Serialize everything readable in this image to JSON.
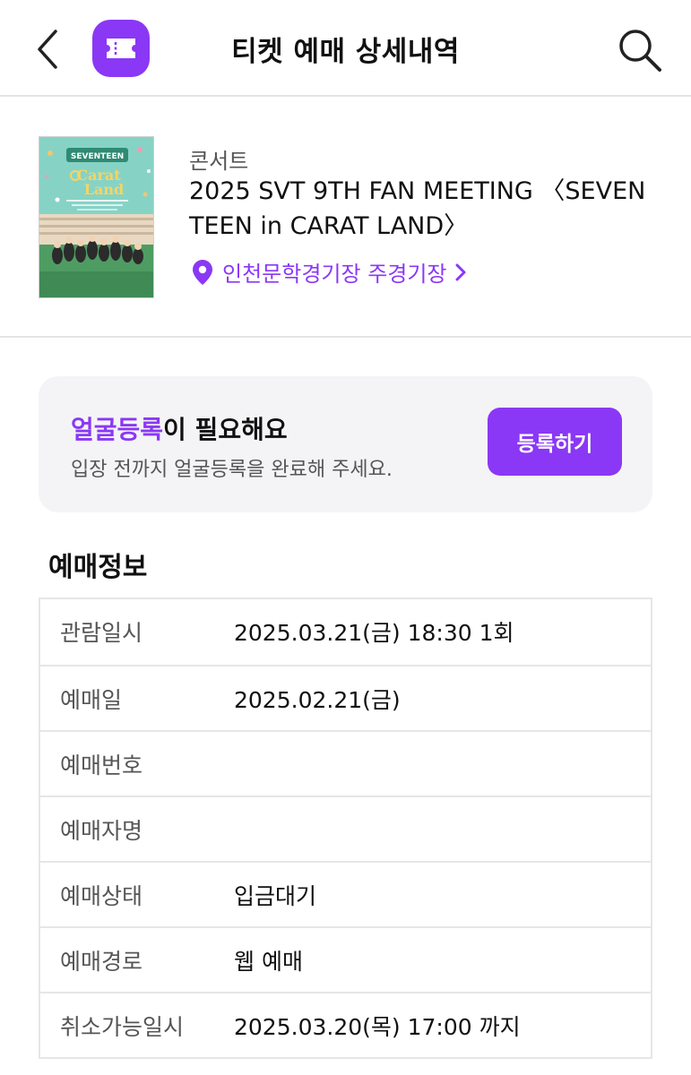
{
  "header": {
    "title": "티켓 예매 상세내역",
    "back_icon": "chevron-left-icon",
    "app_icon": "ticket-icon",
    "search_icon": "search-icon"
  },
  "event": {
    "category": "콘서트",
    "title": "2025 SVT 9TH FAN MEETING 〈SEVENTEEN in CARAT LAND〉",
    "venue": "인천문학경기장 주경기장",
    "poster": {
      "brand": "SEVENTEEN",
      "headline_line1": "Carat",
      "headline_line2": "Land"
    }
  },
  "face_registration": {
    "title_highlight": "얼굴등록",
    "title_rest": "이 필요해요",
    "subtitle": "입장 전까지 얼굴등록을 완료해 주세요.",
    "button_label": "등록하기"
  },
  "reservation": {
    "section_title": "예매정보",
    "rows": [
      {
        "label": "관람일시",
        "value": "2025.03.21(금) 18:30 1회"
      },
      {
        "label": "예매일",
        "value": "2025.02.21(금)"
      },
      {
        "label": "예매번호",
        "value": ""
      },
      {
        "label": "예매자명",
        "value": ""
      },
      {
        "label": "예매상태",
        "value": "입금대기"
      },
      {
        "label": "예매경로",
        "value": "웹 예매"
      },
      {
        "label": "취소가능일시",
        "value": "2025.03.20(목) 17:00 까지"
      }
    ]
  },
  "colors": {
    "accent": "#8a38f5",
    "card_bg": "#f4f4f6",
    "divider": "#e4e4e4"
  }
}
